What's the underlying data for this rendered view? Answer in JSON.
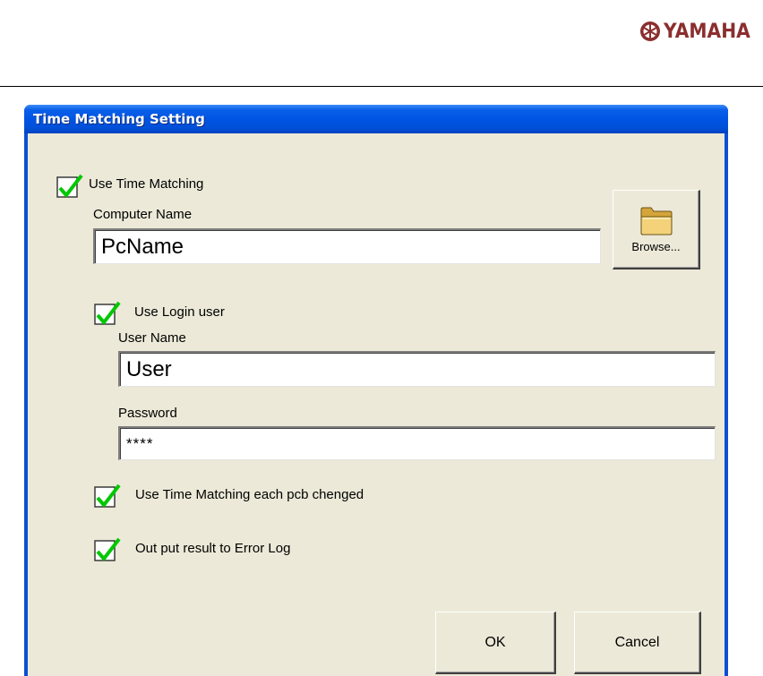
{
  "brand": {
    "name": "YAMAHA"
  },
  "window": {
    "title": "Time Matching Setting"
  },
  "options": {
    "use_time_matching": {
      "label": "Use Time Matching",
      "checked": true
    },
    "use_login_user": {
      "label": "Use Login user",
      "checked": true
    },
    "each_pcb_changed": {
      "label": "Use Time Matching each pcb chenged",
      "checked": true
    },
    "error_log": {
      "label": "Out put result to Error Log",
      "checked": true
    }
  },
  "fields": {
    "computer_name": {
      "label": "Computer Name",
      "value": "PcName"
    },
    "user_name": {
      "label": "User Name",
      "value": "User"
    },
    "password": {
      "label": "Password",
      "value": "****"
    }
  },
  "buttons": {
    "browse": "Browse...",
    "ok": "OK",
    "cancel": "Cancel"
  },
  "colors": {
    "titlebar": "#0054e3",
    "dialog_bg": "#ece9d8",
    "check": "#00c800"
  }
}
